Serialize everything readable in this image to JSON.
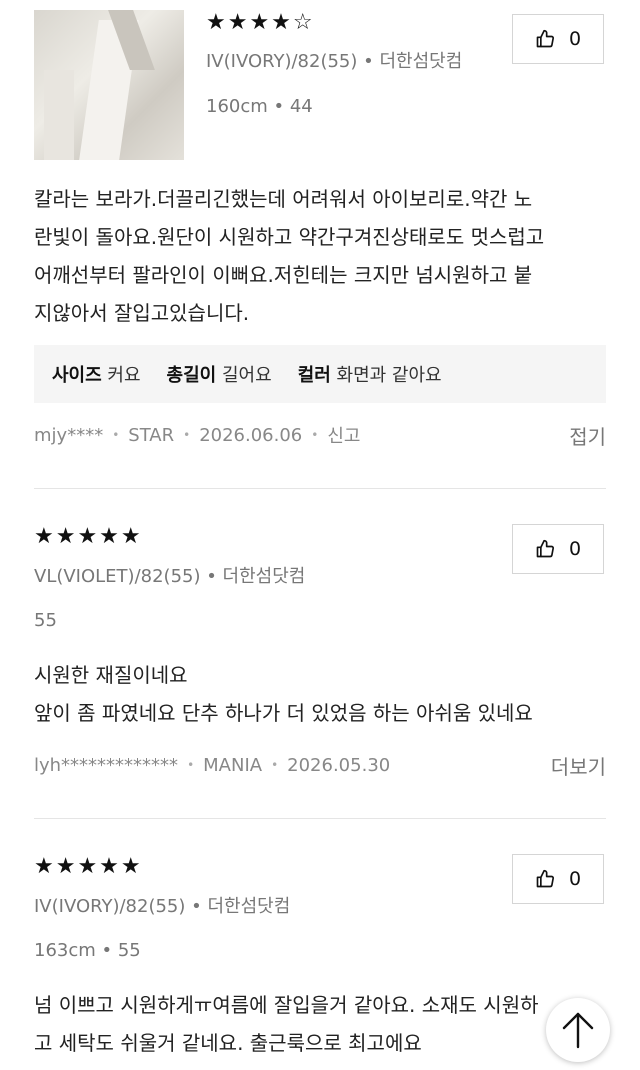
{
  "reviews": [
    {
      "stars": "★★★★☆",
      "option": "IV(IVORY)/82(55) • 더한섬닷컴",
      "size": "160cm • 44",
      "likes": "0",
      "text": [
        "칼라는 보라가.더끌리긴했는데 어려워서 아이보리로.약간  노",
        "란빛이 돌아요.원단이 시원하고 약간구겨진상태로도 멋스럽고",
        "어깨선부터 팔라인이 이뻐요.저힌테는 크지만 넘시원하고 붙",
        "지않아서 잘입고있습니다."
      ],
      "tags": [
        {
          "key": "사이즈",
          "value": "커요"
        },
        {
          "key": "총길이",
          "value": "길어요"
        },
        {
          "key": "컬러",
          "value": "화면과 같아요"
        }
      ],
      "user": "mjy****",
      "grade": "STAR",
      "date": "2026.06.06",
      "report": "신고",
      "action": "접기"
    },
    {
      "stars": "★★★★★",
      "option": "VL(VIOLET)/82(55) • 더한섬닷컴",
      "size": "55",
      "likes": "0",
      "text": [
        "시원한 재질이네요",
        "앞이 좀 파였네요 단추 하나가 더 있었음 하는 아쉬움 있네요"
      ],
      "user": "lyh*************",
      "grade": "MANIA",
      "date": "2026.05.30",
      "action": "더보기"
    },
    {
      "stars": "★★★★★",
      "option": "IV(IVORY)/82(55) • 더한섬닷컴",
      "size": "163cm • 55",
      "likes": "0",
      "text": [
        "넘 이쁘고 시원하게ㅠ여름에 잘입을거 같아요. 소재도 시원하",
        "고 세탁도 쉬울거 같네요. 출근룩으로 최고에요"
      ]
    }
  ],
  "icons": {
    "like": "thumbs-up-icon",
    "top": "arrow-up-icon"
  }
}
